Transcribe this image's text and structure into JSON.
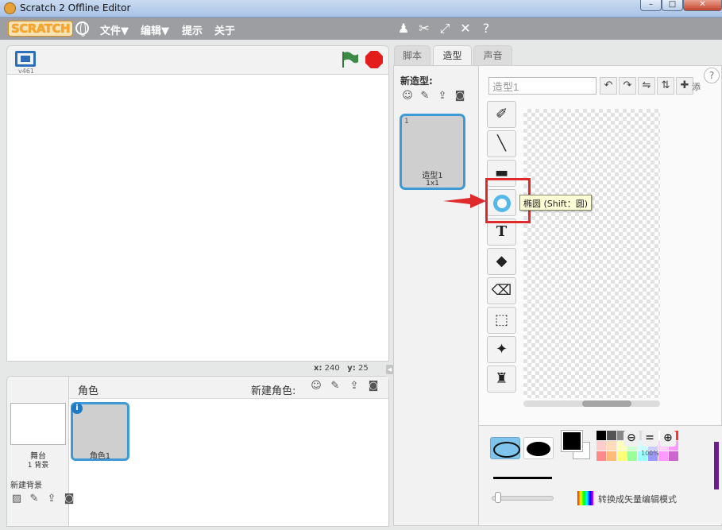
{
  "window": {
    "title": "Scratch 2 Offline Editor"
  },
  "menubar": {
    "logo": "SCRATCH",
    "items": [
      "文件▼",
      "编辑▼",
      "提示",
      "关于"
    ]
  },
  "stage": {
    "version": "v461",
    "coords_x_label": "x:",
    "coords_x": "240",
    "coords_y_label": "y:",
    "coords_y": "25"
  },
  "sprites": {
    "title": "角色",
    "new_sprite_label": "新建角色:",
    "stage_name": "舞台",
    "stage_backdrops": "1 背景",
    "new_backdrop_label": "新建背景",
    "sprite_name": "角色1"
  },
  "tabs": [
    "脚本",
    "造型",
    "声音"
  ],
  "costumes": {
    "new_costume_label": "新造型:",
    "tile_number": "1",
    "tile_name": "造型1",
    "tile_size": "1x1"
  },
  "editor": {
    "costume_name": "造型1",
    "add_label": "添",
    "help": "?",
    "tooltip": "椭圆 (Shift：圆)",
    "zoom_pct": "100%",
    "convert_label": "转换成矢量编辑模式"
  },
  "colors": {
    "accent": "#3e9ad6",
    "highlight": "#e0292b"
  }
}
